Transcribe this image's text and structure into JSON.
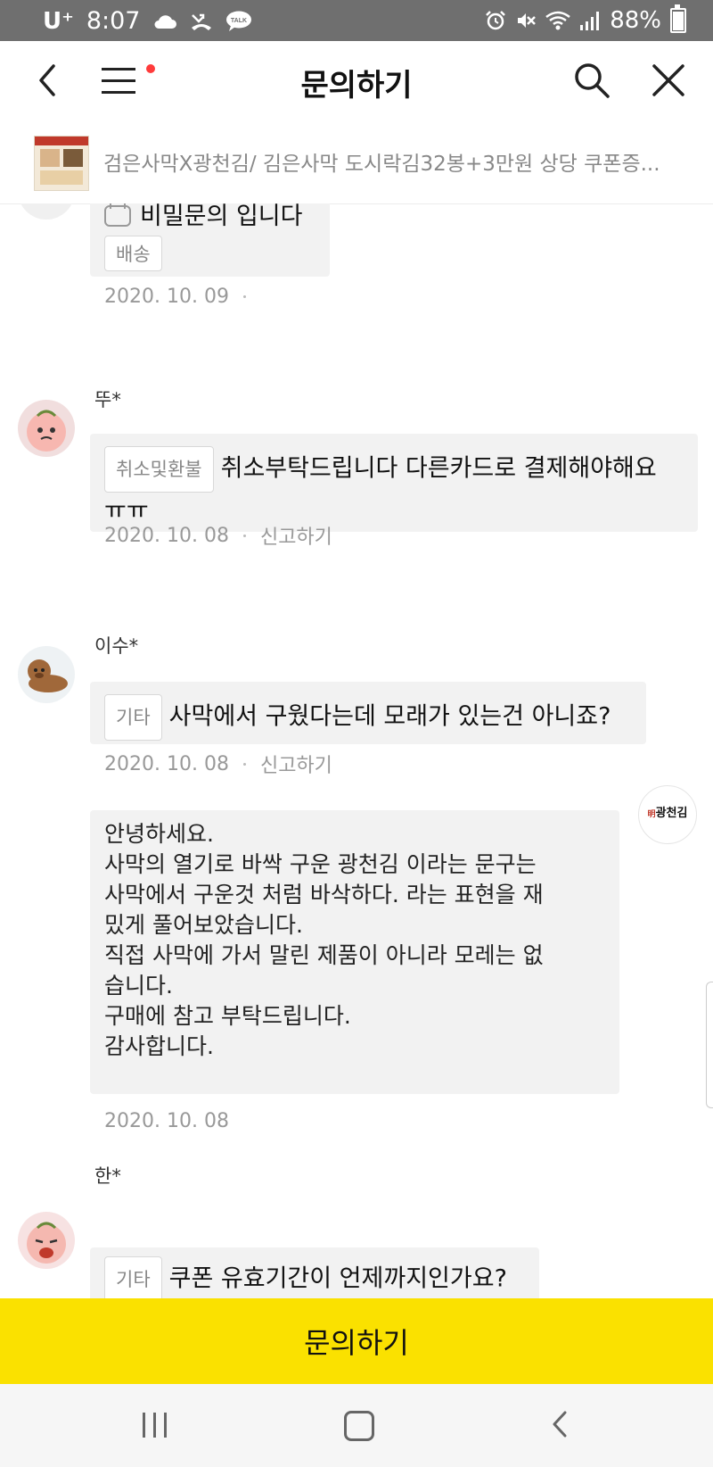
{
  "status_bar": {
    "carrier": "U⁺",
    "time": "8:07",
    "battery": "88%",
    "battery_level": 0.88,
    "icons_left": [
      "cloud-icon",
      "missed-call-icon",
      "talk-icon"
    ],
    "icons_right": [
      "alarm-icon",
      "mute-icon",
      "wifi-icon",
      "signal-icon",
      "battery-icon"
    ]
  },
  "header": {
    "title": "문의하기",
    "back_icon": "back-arrow-icon",
    "menu_icon": "hamburger-menu-icon",
    "search_icon": "search-icon",
    "close_icon": "close-icon",
    "notification_color": "#ff3b3b"
  },
  "product": {
    "name": "검은사막X광천김/ 김은사막 도시락김32봉+3만원 상당 쿠폰증..."
  },
  "threads": [
    {
      "secret_text": "비밀문의 입니다",
      "tag": "배송",
      "date": "2020. 10. 09"
    },
    {
      "author": "뚜*",
      "tag": "취소및환불",
      "question": "취소부탁드립니다 다른카드로 결제해야해요 ㅠㅠ",
      "date": "2020. 10. 08",
      "report": "신고하기"
    },
    {
      "author": "이수*",
      "tag": "기타",
      "question": "사막에서 구웠다는데 모래가 있는건 아니죠?",
      "date": "2020. 10. 08",
      "report": "신고하기",
      "answer": {
        "seller_logo_text": "광천김",
        "seller_logo_prefix": "明",
        "lines": [
          "안녕하세요.",
          "사막의 열기로 바싹 구운 광천김 이라는 문구는",
          "사막에서 구운것 처럼 바삭하다. 라는 표현을 재",
          "밌게 풀어보았습니다.",
          "직접 사막에 가서 말린 제품이 아니라 모레는 없",
          "습니다.",
          "구매에 참고 부탁드립니다.",
          "감사합니다."
        ],
        "date": "2020. 10. 08"
      }
    },
    {
      "author": "한*",
      "tag": "기타",
      "question": "쿠폰 유효기간이 언제까지인가요?"
    }
  ],
  "bottom_button": {
    "label": "문의하기",
    "color": "#fae100"
  },
  "nav_bar": {
    "recent_icon": "recent-apps-icon",
    "home_icon": "home-icon",
    "back_icon": "back-icon"
  }
}
